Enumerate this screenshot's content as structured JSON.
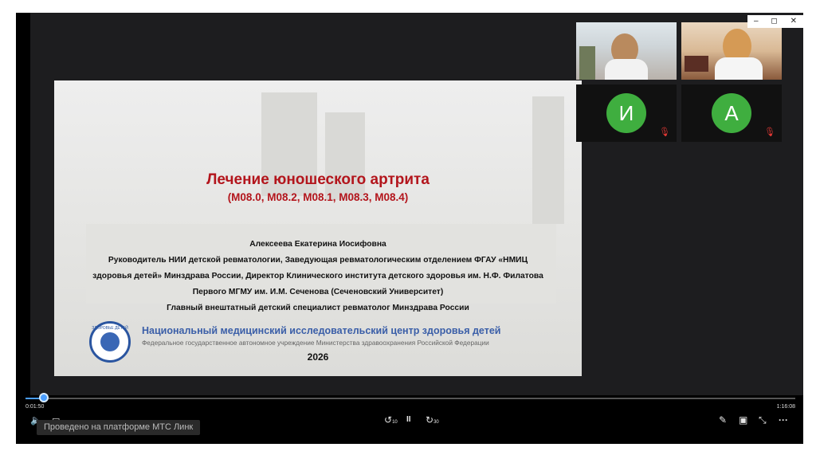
{
  "slide": {
    "title": "Лечение юношеского артрита",
    "codes": "(М08.0, М08.2, М08.1, М08.3, М08.4)",
    "author": "Алексеева Екатерина Иосифовна",
    "lines": [
      "Руководитель НИИ детской ревматологии, Заведующая ревматологическим отделением ФГАУ «НМИЦ",
      "здоровья детей» Минздрава России, Директор Клинического института детского здоровья им. Н.Ф. Филатова",
      "Первого МГМУ им. И.М. Сеченова (Сеченовский Университет)",
      "Главный внештатный детский специалист ревматолог Минздрава России"
    ],
    "org_name": "Национальный медицинский исследовательский центр здоровья детей",
    "org_sub": "Федеральное государственное автономное учреждение Министерства здравоохранения Российской Федерации",
    "year": "2026",
    "logo_text": "ЗДОРОВЬЕ ДЕТЕЙ"
  },
  "participants": [
    {
      "type": "video"
    },
    {
      "type": "video"
    },
    {
      "type": "avatar",
      "initial": "И",
      "muted": true
    },
    {
      "type": "avatar",
      "initial": "А",
      "muted": true
    }
  ],
  "player": {
    "elapsed": "0:01:50",
    "duration": "1:16:08",
    "progress_fraction": 0.024,
    "caption": "Проведено на платформе МТС Линк",
    "accent": "#4a9eff"
  },
  "window_controls": {
    "minimize": "–",
    "restore": "◻",
    "close": "✕"
  },
  "icons": {
    "volume": "🔈",
    "subtitles": "▭",
    "rewind": "↺",
    "rewind_label": "10",
    "pause": "II",
    "forward": "↻",
    "forward_label": "30",
    "pen": "✎",
    "pip": "▣",
    "collapse": "⤡",
    "more": "···",
    "mic_off": "🎙"
  }
}
